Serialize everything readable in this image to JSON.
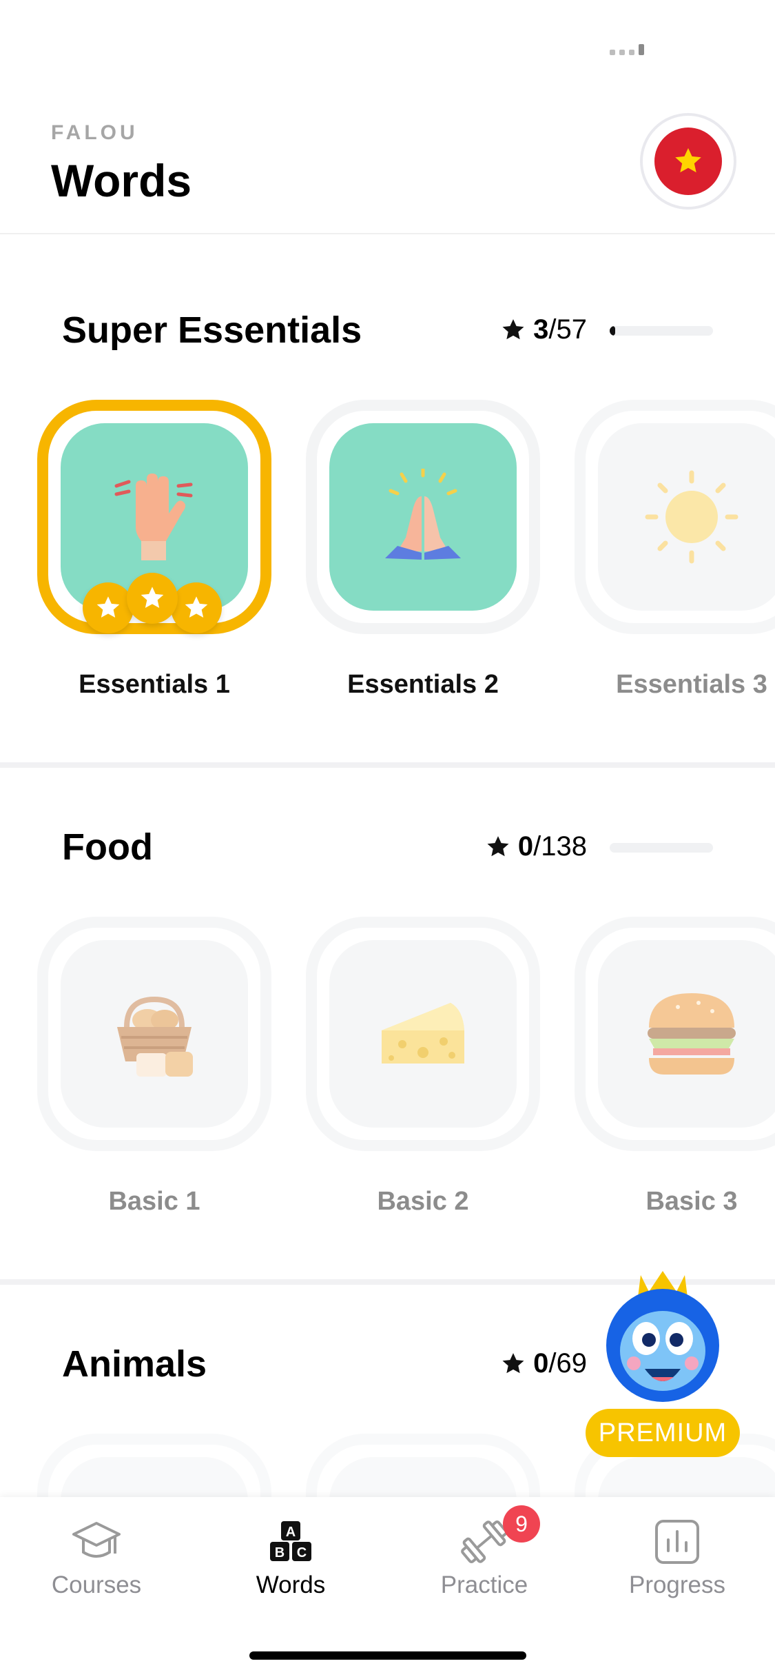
{
  "header": {
    "app_label": "FALOU",
    "title": "Words",
    "flag_icon": "vietnam-flag-icon"
  },
  "sections": [
    {
      "title": "Super Essentials",
      "score": {
        "current": "3",
        "total": "/57"
      },
      "progress": 0.05,
      "tiles": [
        {
          "label": "Essentials 1",
          "icon": "raised-hand-icon",
          "state": "completed",
          "stars": 3
        },
        {
          "label": "Essentials 2",
          "icon": "praying-hands-icon",
          "state": "available"
        },
        {
          "label": "Essentials 3",
          "icon": "sun-icon",
          "state": "locked"
        }
      ]
    },
    {
      "title": "Food",
      "score": {
        "current": "0",
        "total": "/138"
      },
      "progress": 0,
      "tiles": [
        {
          "label": "Basic 1",
          "icon": "bread-basket-icon",
          "state": "locked"
        },
        {
          "label": "Basic 2",
          "icon": "cheese-icon",
          "state": "locked"
        },
        {
          "label": "Basic 3",
          "icon": "burger-icon",
          "state": "locked"
        }
      ]
    },
    {
      "title": "Animals",
      "score": {
        "current": "0",
        "total": "/69"
      }
    }
  ],
  "premium": {
    "label": "PREMIUM",
    "icon": "monkey-mascot-icon"
  },
  "tabbar": {
    "items": [
      {
        "label": "Courses",
        "icon": "graduation-cap-icon"
      },
      {
        "label": "Words",
        "icon": "abc-blocks-icon",
        "active": true
      },
      {
        "label": "Practice",
        "icon": "dumbbell-icon",
        "badge": "9"
      },
      {
        "label": "Progress",
        "icon": "bar-chart-icon"
      }
    ]
  },
  "colors": {
    "gold": "#f7b500",
    "mint": "#85dcc4",
    "badge_red": "#f04452",
    "flag_red": "#da1f2d"
  }
}
